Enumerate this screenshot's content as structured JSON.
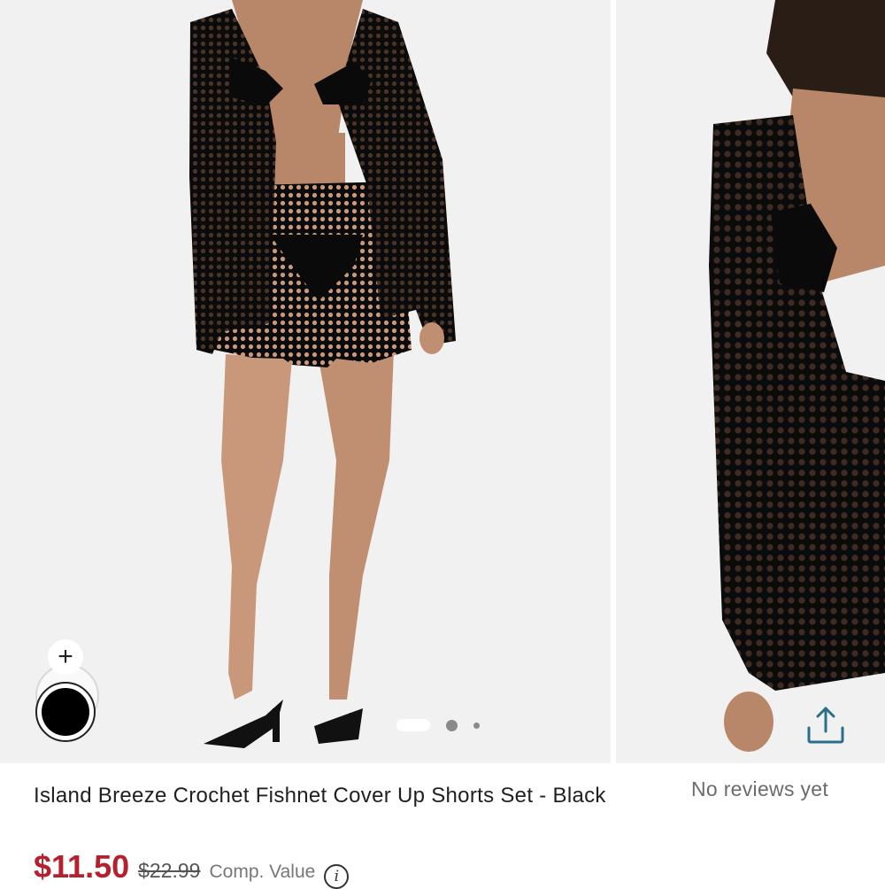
{
  "carousel": {
    "current_index": 1,
    "total_slides": 3
  },
  "swatches": {
    "add_label": "+",
    "selected_color": "#000000"
  },
  "product": {
    "title": "Island Breeze Crochet Fishnet Cover Up Shorts Set - Black",
    "reviews": "No reviews yet",
    "price": "$11.50",
    "original_price": "$22.99",
    "comp_label": "Comp. Value",
    "info_icon_glyph": "i"
  },
  "colors": {
    "price_red": "#b5202e",
    "background": "#f1f1f1"
  },
  "icons": [
    "plus-icon",
    "share-icon",
    "info-icon"
  ]
}
